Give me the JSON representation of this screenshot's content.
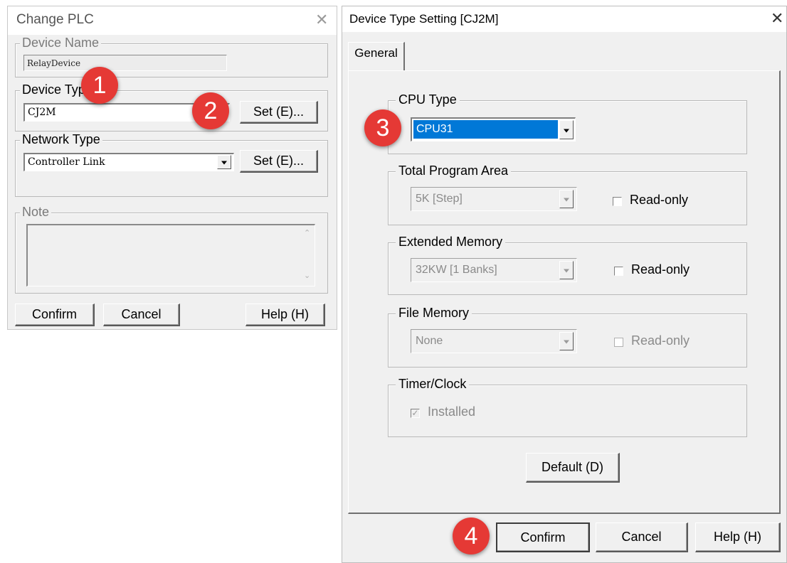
{
  "change_plc": {
    "title": "Change PLC",
    "device_name": {
      "legend": "Device Name",
      "value": "RelayDevice"
    },
    "device_type": {
      "legend": "Device Type",
      "value": "CJ2M",
      "set_label": "Set (E)..."
    },
    "network_type": {
      "legend": "Network Type",
      "value": "Controller Link",
      "set_label": "Set (E)..."
    },
    "note": {
      "legend": "Note",
      "value": ""
    },
    "buttons": {
      "confirm": "Confirm",
      "cancel": "Cancel",
      "help": "Help (H)"
    }
  },
  "device_type_setting": {
    "title": "Device Type Setting [CJ2M]",
    "tab": "General",
    "cpu_type": {
      "legend": "CPU Type",
      "value": "CPU31"
    },
    "total_program_area": {
      "legend": "Total Program Area",
      "value": "5K [Step]",
      "readonly_label": "Read-only",
      "readonly_checked": false
    },
    "extended_memory": {
      "legend": "Extended Memory",
      "value": "32KW [1 Banks]",
      "readonly_label": "Read-only",
      "readonly_checked": false
    },
    "file_memory": {
      "legend": "File Memory",
      "value": "None",
      "readonly_label": "Read-only",
      "readonly_checked": false
    },
    "timer_clock": {
      "legend": "Timer/Clock",
      "installed_label": "Installed",
      "installed_checked": true
    },
    "default_button": "Default (D)",
    "buttons": {
      "confirm": "Confirm",
      "cancel": "Cancel",
      "help": "Help (H)"
    }
  },
  "annotations": [
    "1",
    "2",
    "3",
    "4"
  ],
  "colors": {
    "badge": "#e53935",
    "selection": "#0078d7"
  }
}
